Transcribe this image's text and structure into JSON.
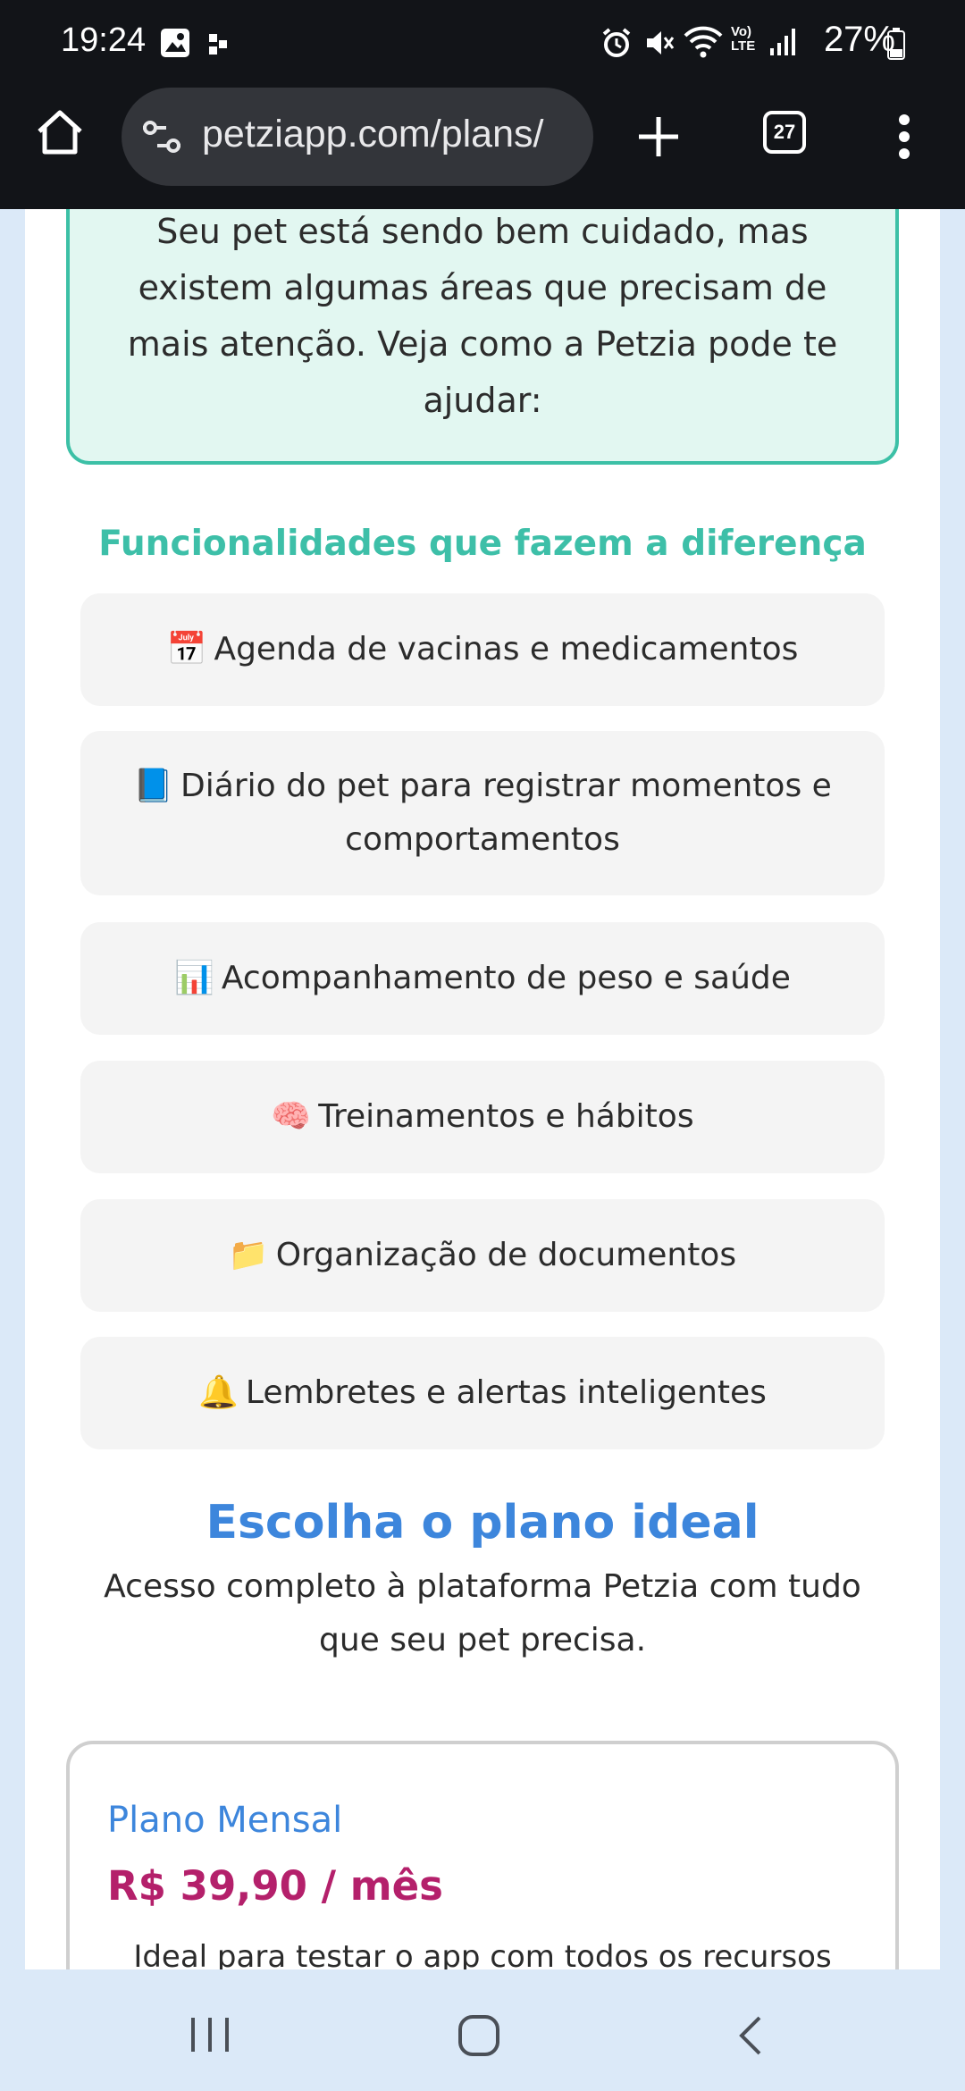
{
  "status_bar": {
    "time": "19:24",
    "battery": "27%",
    "icons": [
      "gallery-icon",
      "dots-icon",
      "alarm-icon",
      "mute-icon",
      "wifi-icon",
      "volte-icon",
      "signal-icon",
      "battery-icon"
    ],
    "volte_label": "Vo) LTE"
  },
  "browser": {
    "url": "petziapp.com/plans/",
    "tab_count": "27"
  },
  "info": {
    "text": "Seu pet está sendo bem cuidado, mas existem algumas áreas que precisam de mais atenção. Veja como a Petzia pode te ajudar:"
  },
  "features": {
    "title": "Funcionalidades que fazem a diferença",
    "items": [
      {
        "emoji": "📅",
        "label": "Agenda de vacinas e medicamentos"
      },
      {
        "emoji": "📘",
        "label": "Diário do pet para registrar momentos e comportamentos"
      },
      {
        "emoji": "📊",
        "label": "Acompanhamento de peso e saúde"
      },
      {
        "emoji": "🧠",
        "label": "Treinamentos e hábitos"
      },
      {
        "emoji": "📁",
        "label": "Organização de documentos"
      },
      {
        "emoji": "🔔",
        "label": "Lembretes e alertas inteligentes"
      }
    ]
  },
  "plans": {
    "title": "Escolha o plano ideal",
    "subtitle": "Acesso completo à plataforma Petzia com tudo que seu pet precisa.",
    "monthly": {
      "name": "Plano Mensal",
      "price": "R$ 39,90 / mês",
      "description": "Ideal para testar o app com todos os recursos"
    }
  },
  "colors": {
    "accent_teal": "#3cc0a6",
    "accent_blue": "#3d86dc",
    "price_magenta": "#b4206b",
    "info_bg": "#e2f7f1"
  }
}
